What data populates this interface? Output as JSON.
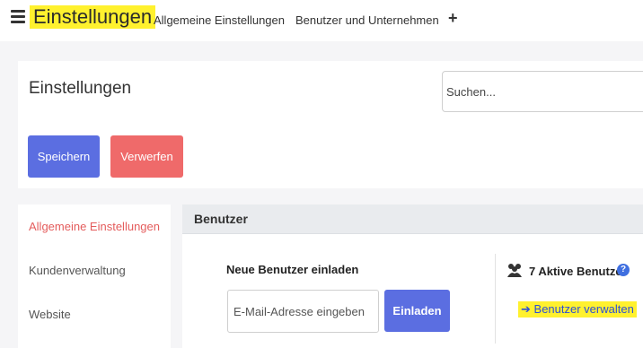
{
  "topbar": {
    "brand": "Einstellungen",
    "links": [
      "Allgemeine Einstellungen",
      "Benutzer und Unternehmen"
    ],
    "add_label": "+"
  },
  "header": {
    "title": "Einstellungen",
    "search_placeholder": "Suchen...",
    "save_label": "Speichern",
    "discard_label": "Verwerfen"
  },
  "sidebar": {
    "items": [
      {
        "label": "Allgemeine Einstellungen",
        "active": true
      },
      {
        "label": "Kundenverwaltung",
        "active": false
      },
      {
        "label": "Website",
        "active": false
      }
    ]
  },
  "users_section": {
    "title": "Benutzer",
    "invite_title": "Neue Benutzer einladen",
    "email_placeholder": "E-Mail-Adresse eingeben",
    "invite_label": "Einladen",
    "active_users": "7 Aktive Benutzer",
    "help_icon": "?",
    "manage_arrow": "➔",
    "manage_label": "Benutzer verwalten"
  },
  "colors": {
    "primary": "#5b6ee1",
    "danger": "#ef6a6a",
    "highlight": "#fff12e",
    "active_menu": "#e45c5c",
    "link": "#2d4fd6"
  }
}
